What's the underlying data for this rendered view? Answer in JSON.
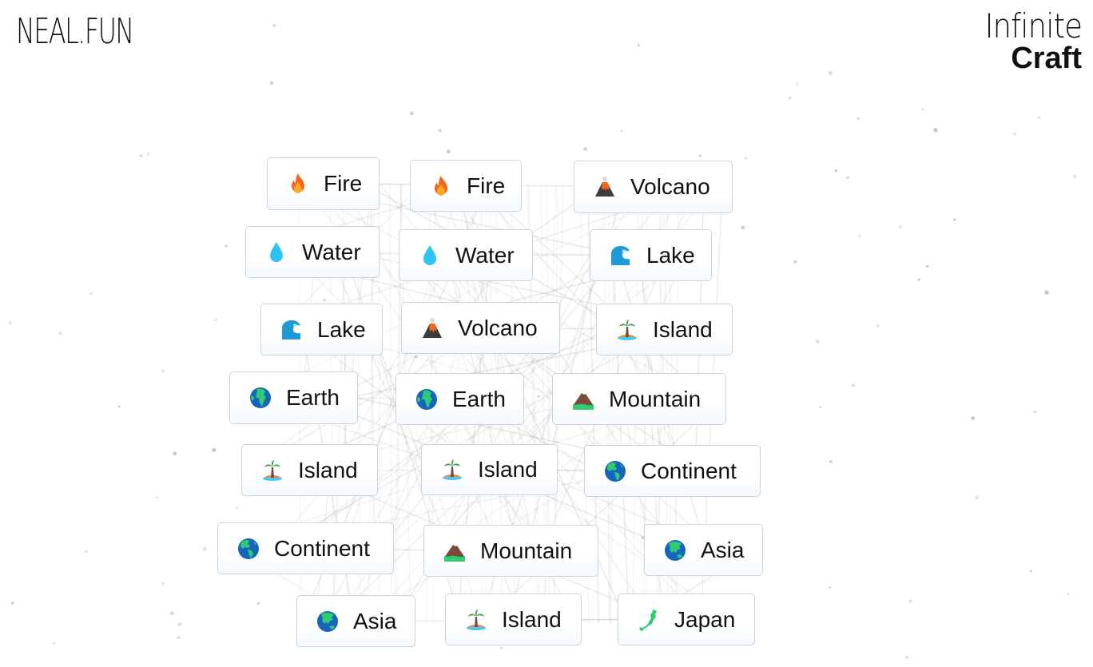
{
  "header": {
    "site_logo": "NEAL.FUN",
    "app_title_line1": "Infinite",
    "app_title_line2": "Craft"
  },
  "items": [
    {
      "label": "Fire",
      "icon": "fire-icon"
    },
    {
      "label": "Fire",
      "icon": "fire-icon"
    },
    {
      "label": "Volcano",
      "icon": "volcano-icon"
    },
    {
      "label": "Water",
      "icon": "water-drop-icon"
    },
    {
      "label": "Water",
      "icon": "water-drop-icon"
    },
    {
      "label": "Lake",
      "icon": "wave-icon"
    },
    {
      "label": "Lake",
      "icon": "wave-icon"
    },
    {
      "label": "Volcano",
      "icon": "volcano-icon"
    },
    {
      "label": "Island",
      "icon": "island-icon"
    },
    {
      "label": "Earth",
      "icon": "globe-africa-icon"
    },
    {
      "label": "Earth",
      "icon": "globe-africa-icon"
    },
    {
      "label": "Mountain",
      "icon": "mountain-icon"
    },
    {
      "label": "Island",
      "icon": "island-icon"
    },
    {
      "label": "Island",
      "icon": "island-icon"
    },
    {
      "label": "Continent",
      "icon": "globe-americas-icon"
    },
    {
      "label": "Continent",
      "icon": "globe-americas-icon"
    },
    {
      "label": "Mountain",
      "icon": "mountain-icon"
    },
    {
      "label": "Asia",
      "icon": "globe-asia-icon"
    },
    {
      "label": "Asia",
      "icon": "globe-asia-icon"
    },
    {
      "label": "Island",
      "icon": "island-icon"
    },
    {
      "label": "Japan",
      "icon": "japan-map-icon"
    }
  ],
  "colors": {
    "item_border": "#c8d4e2",
    "link_line": "#d0d0d0",
    "star_dot": "#cfcfcf",
    "text": "#111111"
  }
}
